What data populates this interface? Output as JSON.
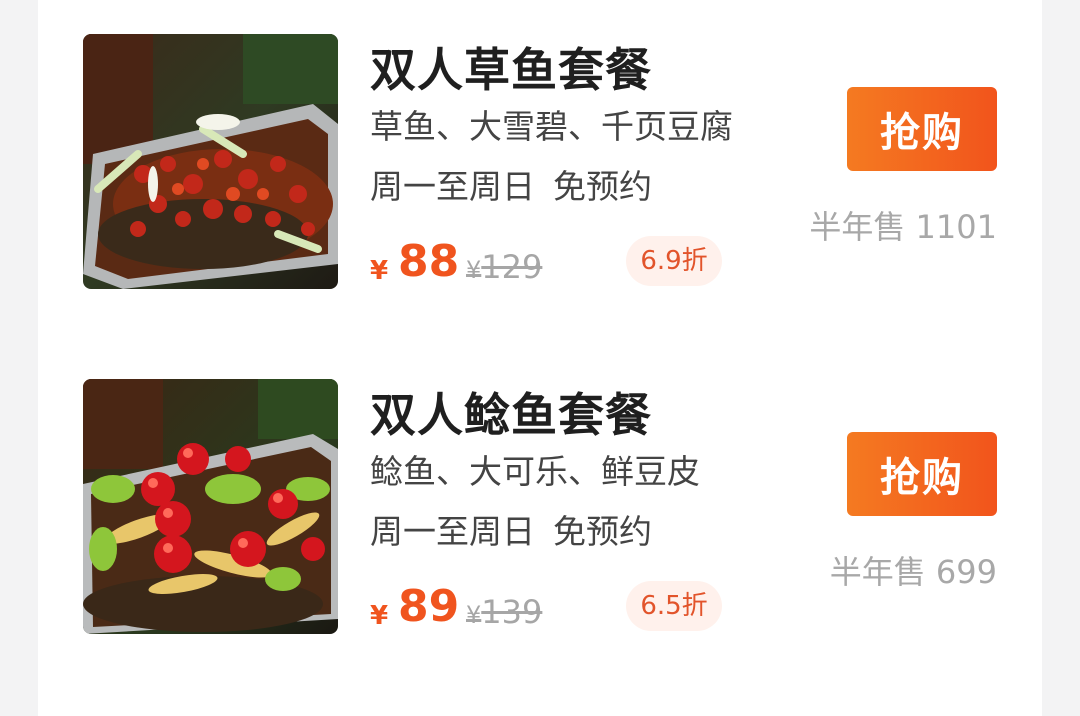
{
  "items": [
    {
      "title": "双人草鱼套餐",
      "dishes": "草鱼、大雪碧、千页豆腐",
      "days": "周一至周日",
      "reservation": "免预约",
      "currency": "¥",
      "price": "88",
      "original_price": "129",
      "discount": "6.9折",
      "buy_label": "抢购",
      "sold": "半年售 1101",
      "image_icon": "grilled-fish-chili-photo"
    },
    {
      "title": "双人鲶鱼套餐",
      "dishes": "鲶鱼、大可乐、鲜豆皮",
      "days": "周一至周日",
      "reservation": "免预约",
      "currency": "¥",
      "price": "89",
      "original_price": "139",
      "discount": "6.5折",
      "buy_label": "抢购",
      "sold": "半年售 699",
      "image_icon": "grilled-fish-peppers-photo"
    }
  ],
  "colors": {
    "accent": "#f0541e",
    "button_start": "#f47a21",
    "button_end": "#f2541c",
    "discount_bg": "#fff1ec",
    "muted": "#a8a8a8"
  }
}
